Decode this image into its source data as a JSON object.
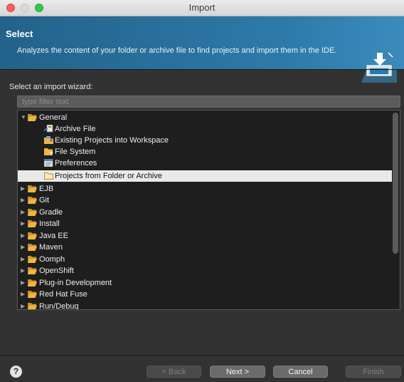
{
  "window": {
    "title": "Import"
  },
  "header": {
    "title": "Select",
    "description": "Analyzes the content of your folder or archive file to find projects and import them in the IDE."
  },
  "wizard": {
    "label": "Select an import wizard:",
    "filter_placeholder": "type filter text"
  },
  "tree": {
    "items": [
      {
        "label": "General",
        "expanded": true,
        "icon": "folder-open-icon"
      },
      {
        "label": "Archive File",
        "icon": "archive-file-icon"
      },
      {
        "label": "Existing Projects into Workspace",
        "icon": "existing-projects-icon"
      },
      {
        "label": "File System",
        "icon": "file-system-icon"
      },
      {
        "label": "Preferences",
        "icon": "preferences-icon"
      },
      {
        "label": "Projects from Folder or Archive",
        "icon": "folder-outline-icon",
        "selected": true
      },
      {
        "label": "EJB",
        "expanded": false,
        "icon": "folder-icon"
      },
      {
        "label": "Git",
        "expanded": false,
        "icon": "folder-icon"
      },
      {
        "label": "Gradle",
        "expanded": false,
        "icon": "folder-icon"
      },
      {
        "label": "Install",
        "expanded": false,
        "icon": "folder-icon"
      },
      {
        "label": "Java EE",
        "expanded": false,
        "icon": "folder-icon"
      },
      {
        "label": "Maven",
        "expanded": false,
        "icon": "folder-icon"
      },
      {
        "label": "Oomph",
        "expanded": false,
        "icon": "folder-icon"
      },
      {
        "label": "OpenShift",
        "expanded": false,
        "icon": "folder-icon"
      },
      {
        "label": "Plug-in Development",
        "expanded": false,
        "icon": "folder-icon"
      },
      {
        "label": "Red Hat Fuse",
        "expanded": false,
        "icon": "folder-icon"
      },
      {
        "label": "Run/Debug",
        "expanded": false,
        "icon": "folder-icon"
      }
    ]
  },
  "footer": {
    "help_label": "?",
    "back_label": "< Back",
    "next_label": "Next >",
    "cancel_label": "Cancel",
    "finish_label": "Finish"
  },
  "colors": {
    "banner": "#2d7aa9",
    "folder": "#f0b541",
    "selection": "#e9e9e9"
  }
}
